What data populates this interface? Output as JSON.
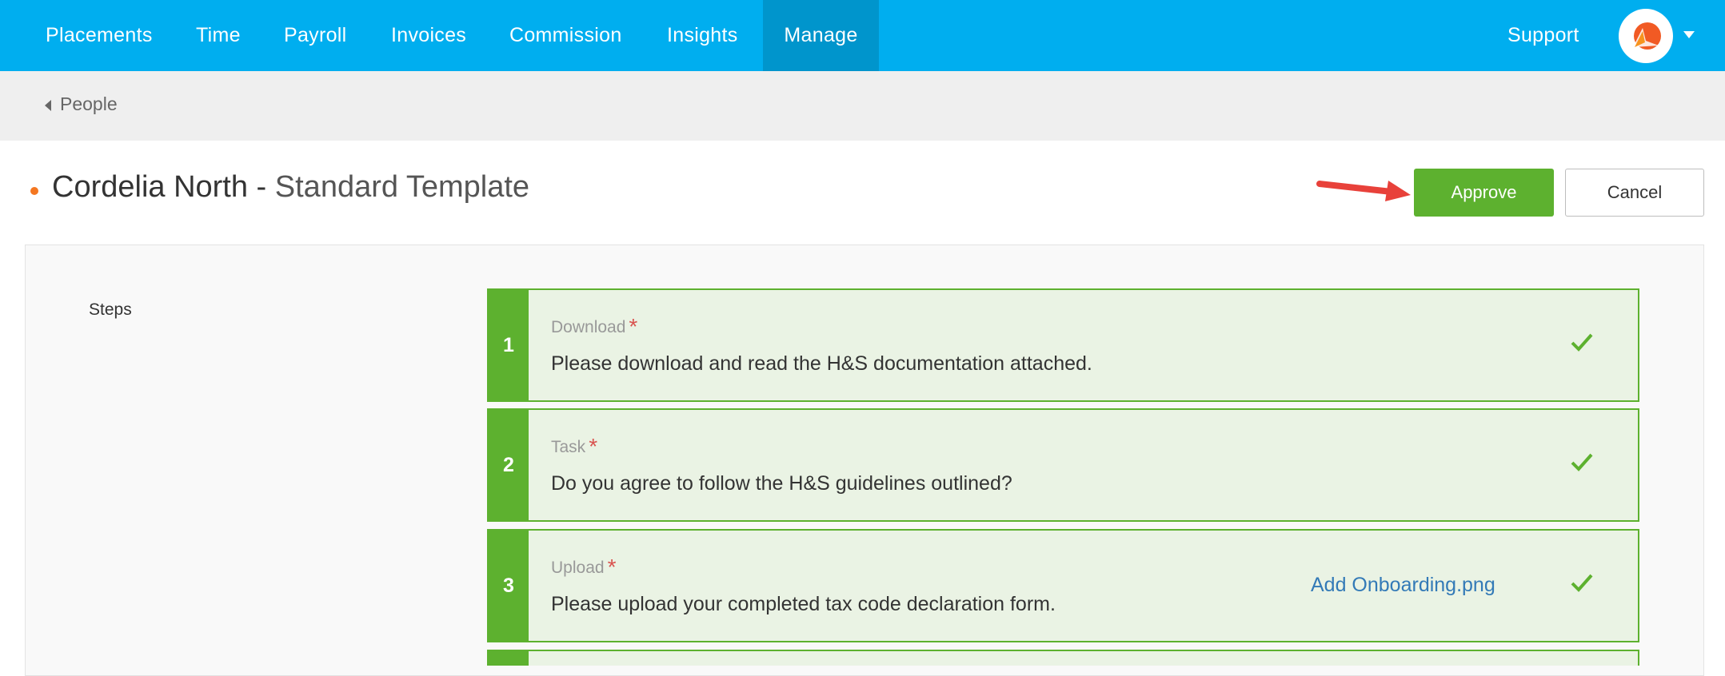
{
  "nav": {
    "items": [
      {
        "label": "Placements"
      },
      {
        "label": "Time"
      },
      {
        "label": "Payroll"
      },
      {
        "label": "Invoices"
      },
      {
        "label": "Commission"
      },
      {
        "label": "Insights"
      },
      {
        "label": "Manage",
        "active": true
      }
    ],
    "support_label": "Support"
  },
  "breadcrumb": {
    "back_label": "People"
  },
  "header": {
    "name": "Cordelia North",
    "separator": " - ",
    "template": "Standard Template",
    "status_dot_color": "#f47721"
  },
  "actions": {
    "approve_label": "Approve",
    "cancel_label": "Cancel"
  },
  "steps_label": "Steps",
  "steps": [
    {
      "number": "1",
      "type": "Download",
      "required": "*",
      "text": "Please download and read the H&S documentation attached.",
      "completed": true
    },
    {
      "number": "2",
      "type": "Task",
      "required": "*",
      "text": "Do you agree to follow the H&S guidelines outlined?",
      "completed": true
    },
    {
      "number": "3",
      "type": "Upload",
      "required": "*",
      "text": "Please upload your completed tax code declaration form.",
      "file": "Add Onboarding.png",
      "completed": true
    }
  ],
  "colors": {
    "nav_bg": "#00aeef",
    "nav_active": "#0095cc",
    "approve": "#5db12f",
    "step_bg": "#eaf3e4",
    "arrow": "#e8413a"
  }
}
